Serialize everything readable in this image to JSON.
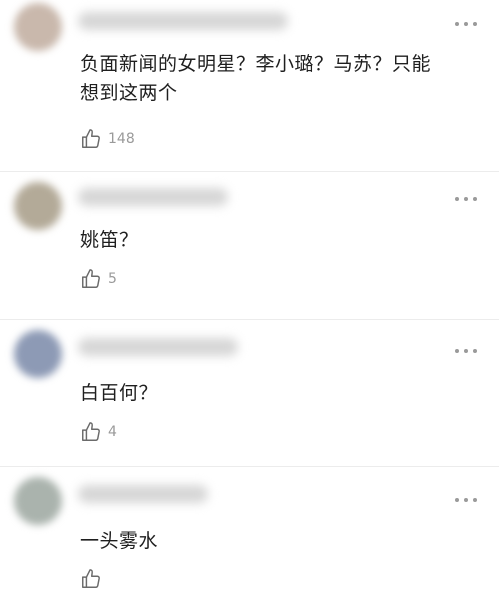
{
  "comments": [
    {
      "text": "负面新闻的女明星？李小璐？马苏？只能想到这两个",
      "likes": "148",
      "avatar_color": "#c9b8ac"
    },
    {
      "text": "姚笛？",
      "likes": "5",
      "avatar_color": "#b3aa98"
    },
    {
      "text": "白百何？",
      "likes": "4",
      "avatar_color": "#8d9ab5"
    },
    {
      "text": "一头雾水",
      "likes": "",
      "avatar_color": "#aab3ad"
    }
  ],
  "icons": {
    "like": "thumbs-up-icon",
    "more": "more-dots-icon"
  },
  "colors": {
    "text": "#1f1f1f",
    "meta": "#9a9a9a",
    "divider": "#ececec"
  }
}
